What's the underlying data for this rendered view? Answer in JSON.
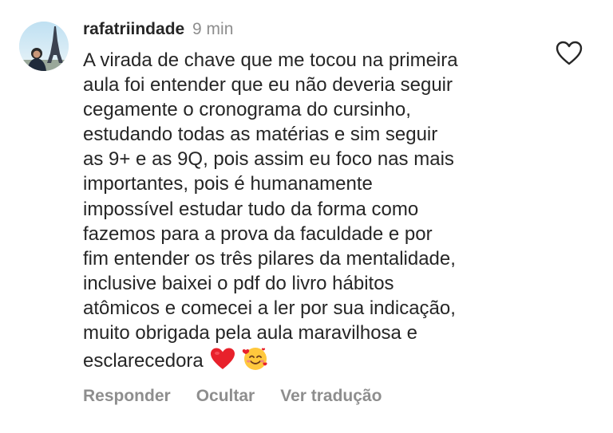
{
  "comment": {
    "username": "rafatriindade",
    "time": "9 min",
    "text": "A virada de chave que me tocou na primeira\naula foi entender que eu não deveria seguir\ncegamente o cronograma do cursinho,\nestudando todas as matérias e sim seguir\nas 9+ e as 9Q, pois assim eu foco nas mais\nimportantes, pois é humanamente\nimpossível estudar tudo da forma como\nfazemos para a prova da faculdade e por\nfim entender os três pilares da mentalidade,\ninclusive baixei o pdf do livro hábitos\natômicos e comecei a ler por sua indicação,\nmuito obrigada pela aula maravilhosa e\nesclarecedora",
    "emojis": [
      "red-heart-emoji",
      "smiling-face-with-hearts-emoji"
    ]
  },
  "actions": {
    "reply": "Responder",
    "hide": "Ocultar",
    "translate": "Ver tradução"
  },
  "icons": {
    "like": "heart-outline-icon"
  },
  "colors": {
    "text": "#262626",
    "secondary": "#8e8e8e",
    "heart_emoji": "#e8212b"
  }
}
